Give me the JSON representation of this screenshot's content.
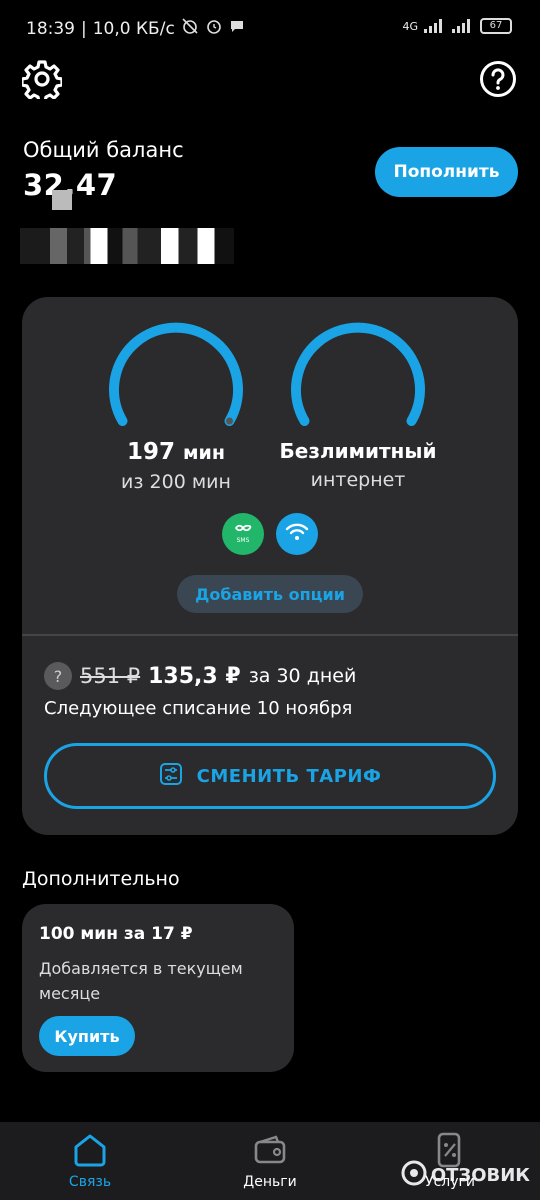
{
  "status_bar": {
    "time": "18:39",
    "speed": "10,0 КБ/с",
    "network": "4G",
    "battery": "67"
  },
  "header": {
    "balance_label": "Общий баланс",
    "balance_value": "32,47",
    "topup_label": "Пополнить"
  },
  "tariff": {
    "minutes_value": "197",
    "minutes_unit": "мин",
    "minutes_left": 197,
    "minutes_total": 200,
    "minutes_sub": "из 200 мин",
    "internet_main": "Безлимитный",
    "internet_sub": "интернет",
    "add_options_label": "Добавить опции",
    "price_help": "?",
    "old_price": "551 ₽",
    "new_price": "135,3 ₽",
    "period": "за 30 дней",
    "next_charge": "Следующее списание 10 ноября",
    "change_tariff_label": "СМЕНИТЬ ТАРИФ",
    "sms_icon_text": "SMS"
  },
  "extra": {
    "section_title": "Дополнительно",
    "addon_title": "100 мин за 17 ₽",
    "addon_desc": "Добавляется в текущем месяце",
    "buy_label": "Купить"
  },
  "bottom_nav": {
    "items": [
      {
        "label": "Связь",
        "icon": "house-icon",
        "active": true
      },
      {
        "label": "Деньги",
        "icon": "wallet-icon",
        "active": false
      },
      {
        "label": "Услуги",
        "icon": "phone-percent-icon",
        "active": false
      }
    ]
  },
  "watermark": "ОТЗОВИК",
  "colors": {
    "accent": "#1aa4e6",
    "card": "#2b2b2d",
    "sms_green": "#22b66a",
    "background": "#000000"
  }
}
